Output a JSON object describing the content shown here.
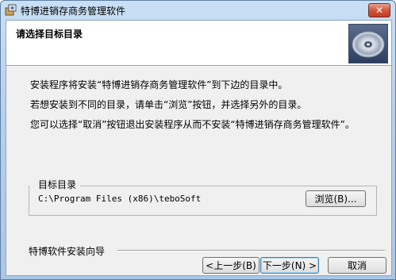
{
  "window": {
    "title": "特博进销存商务管理软件",
    "close_label": "✕"
  },
  "header": {
    "title": "请选择目标目录"
  },
  "body": {
    "line1": "安装程序将安装“特博进销存商务管理软件”到下边的目录中。",
    "line2": "若想安装到不同的目录，请单击“浏览”按钮，并选择另外的目录。",
    "line3": "您可以选择“取消”按钮退出安装程序从而不安装“特博进销存商务管理软件”。"
  },
  "destination": {
    "group_label": "目标目录",
    "path": "C:\\Program Files (x86)\\teboSoft",
    "browse_label": "浏览(B)..."
  },
  "footer": {
    "label": "特博软件安装向导",
    "back_label": "<上一步(B)",
    "next_label": "下一步(N) >",
    "cancel_label": "取消"
  },
  "icons": {
    "app": "installer-icon",
    "header": "disc-icon"
  }
}
